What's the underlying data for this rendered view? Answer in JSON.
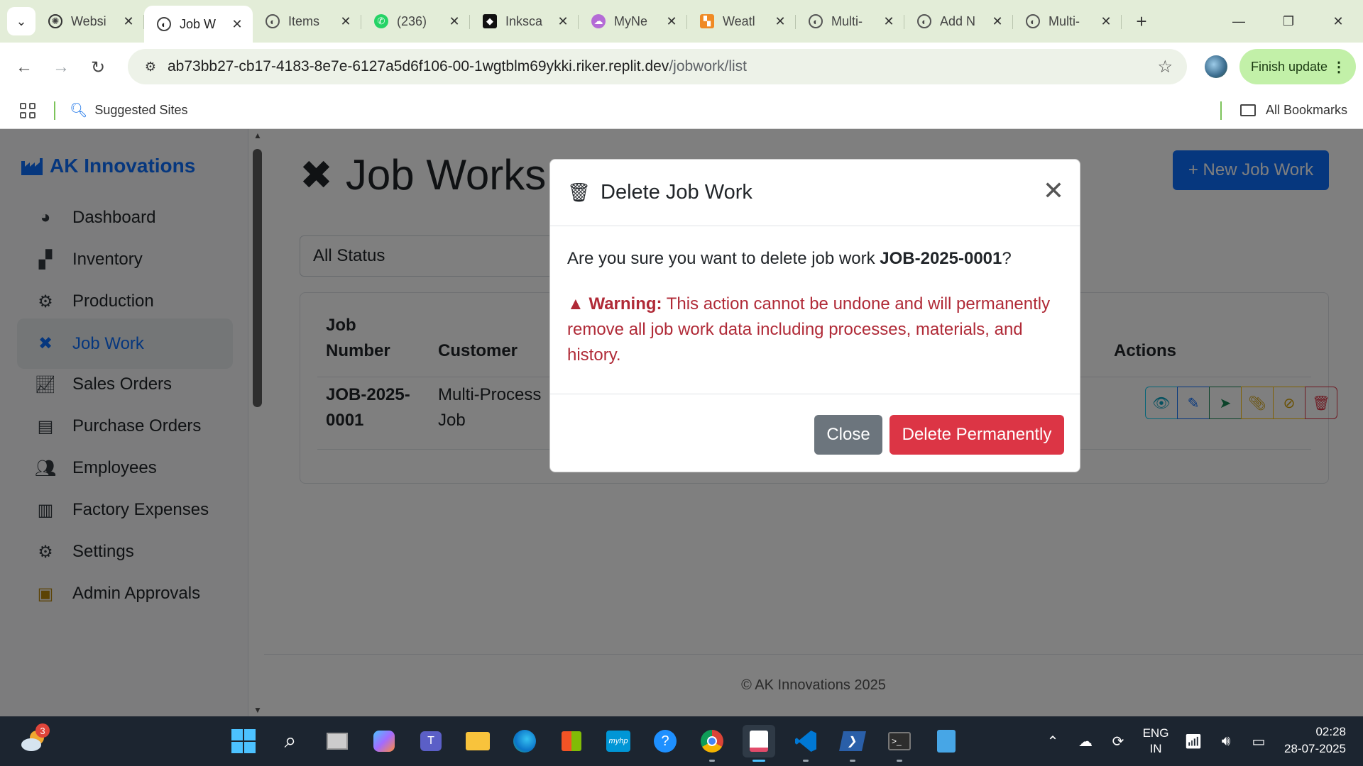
{
  "browser": {
    "tabs": [
      {
        "title": "Websi",
        "icon": "openai-icon",
        "active": false
      },
      {
        "title": "Job W",
        "icon": "globe-icon",
        "active": true
      },
      {
        "title": "Items",
        "icon": "globe-icon",
        "active": false
      },
      {
        "title": "(236)",
        "icon": "whatsapp-icon",
        "active": false
      },
      {
        "title": "Inksca",
        "icon": "inkscape-icon",
        "active": false
      },
      {
        "title": "MyNe",
        "icon": "cloud-icon",
        "active": false
      },
      {
        "title": "Weatl",
        "icon": "weather-icon",
        "active": false
      },
      {
        "title": "Multi-",
        "icon": "globe-icon",
        "active": false
      },
      {
        "title": "Add N",
        "icon": "globe-icon",
        "active": false
      },
      {
        "title": "Multi-",
        "icon": "globe-icon",
        "active": false
      }
    ],
    "url_main": "ab73bb27-cb17-4183-8e7e-6127a5d6f106-00-1wgtblm69ykki.riker.replit.dev",
    "url_path": "/jobwork/list",
    "finish_update": "Finish update",
    "bookmarks": {
      "suggested": "Suggested Sites",
      "all": "All Bookmarks"
    }
  },
  "app": {
    "brand": "AK Innovations",
    "nav": [
      {
        "label": "Dashboard",
        "icon": "palette-icon"
      },
      {
        "label": "Inventory",
        "icon": "boxes-icon"
      },
      {
        "label": "Production",
        "icon": "cogs-icon"
      },
      {
        "label": "Job Work",
        "icon": "tools-icon",
        "active": true
      },
      {
        "label": "Sales Orders",
        "icon": "chart-line-icon"
      },
      {
        "label": "Purchase Orders",
        "icon": "file-invoice-icon"
      },
      {
        "label": "Employees",
        "icon": "users-icon"
      },
      {
        "label": "Factory Expenses",
        "icon": "receipt-icon"
      },
      {
        "label": "Settings",
        "icon": "gear-icon"
      },
      {
        "label": "Admin Approvals",
        "icon": "clipboard-check-icon"
      }
    ],
    "page_title": "Job Works",
    "new_button": "+ New Job Work",
    "filter_status": "All Status",
    "table": {
      "headers": {
        "job_number": "Job Number",
        "customer": "Customer",
        "actions": "Actions"
      },
      "rows": [
        {
          "job_number": "JOB-2025-0001",
          "customer": "Multi-Process Job"
        }
      ]
    },
    "footer": "© AK Innovations 2025"
  },
  "modal": {
    "title": "Delete Job Work",
    "question_prefix": "Are you sure you want to delete job work ",
    "job_id": "JOB-2025-0001",
    "question_suffix": "?",
    "warning_label": "Warning:",
    "warning_text": " This action cannot be undone and will permanently remove all job work data including processes, materials, and history.",
    "close_label": "Close",
    "delete_label": "Delete Permanently"
  },
  "taskbar": {
    "weather_badge": "3",
    "lang_line1": "ENG",
    "lang_line2": "IN",
    "time": "02:28",
    "date": "28-07-2025"
  },
  "colors": {
    "primary": "#0d6efd",
    "danger": "#dc3545",
    "secondary": "#6c757d",
    "info": "#0dcaf0",
    "success": "#198754",
    "warning": "#ffc107"
  }
}
